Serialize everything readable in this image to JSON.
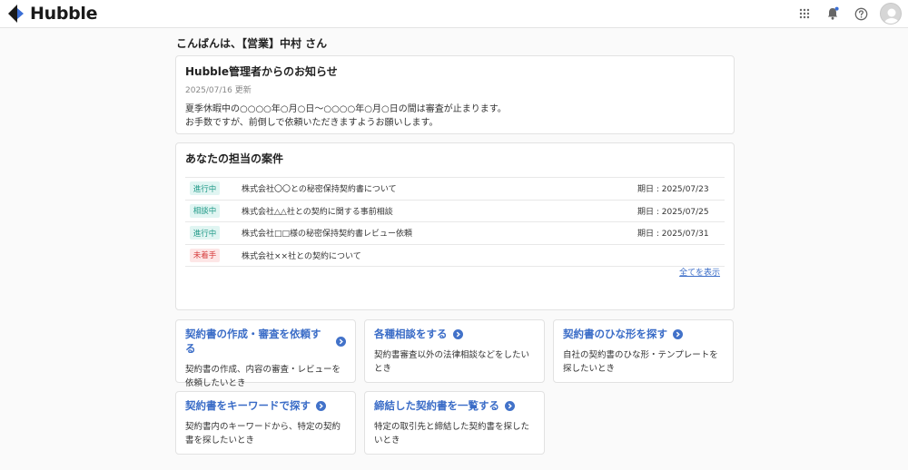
{
  "app": {
    "logo_text": "Hubble"
  },
  "header": {
    "icons": [
      "apps-grid-icon",
      "bell-icon",
      "help-icon",
      "user-avatar"
    ],
    "colors": {
      "notification_dot": "#3b6fd6"
    }
  },
  "greeting": "こんばんは、【営業】中村 さん",
  "notice": {
    "title": "Hubble管理者からのお知らせ",
    "date": "2025/07/16 更新",
    "lines": [
      "夏季休暇中の○○○○年○月○日〜○○○○年○月○日の間は審査が止まります。",
      "お手数ですが、前倒しで依頼いただきますようお願いします。"
    ]
  },
  "cases": {
    "title": "あなたの担当の案件",
    "rows": [
      {
        "status": "進行中",
        "status_color": "#1f9987",
        "name": "株式会社〇〇との秘密保持契約書について",
        "due": "期日 : 2025/07/23"
      },
      {
        "status": "相談中",
        "status_color": "#1f9987",
        "name": "株式会社△△社との契約に関する事前相談",
        "due": "期日 : 2025/07/25"
      },
      {
        "status": "進行中",
        "status_color": "#1f9987",
        "name": "株式会社□□様の秘密保持契約書レビュー依頼",
        "due": "期日 : 2025/07/31"
      },
      {
        "status": "未着手",
        "status_color": "#d53a3a",
        "name": "株式会社××社との契約について",
        "due": ""
      }
    ],
    "show_all": "全てを表示"
  },
  "actions": [
    {
      "title": "契約書の作成・審査を依頼する",
      "desc1": "契約書の作成、内容の審査・レビューを",
      "desc2": "依頼したいとき"
    },
    {
      "title": "各種相談をする",
      "desc1": "契約書審査以外の法律相談などをしたい",
      "desc2": "とき"
    },
    {
      "title": "契約書のひな形を探す",
      "desc1": "自社の契約書のひな形・テンプレートを",
      "desc2": "探したいとき"
    },
    {
      "title": "契約書をキーワードで探す",
      "desc1": "契約書内のキーワードから、特定の契約",
      "desc2": "書を探したいとき"
    },
    {
      "title": "締結した契約書を一覧する",
      "desc1": "特定の取引先と締結した契約書を探した",
      "desc2": "いとき"
    }
  ]
}
